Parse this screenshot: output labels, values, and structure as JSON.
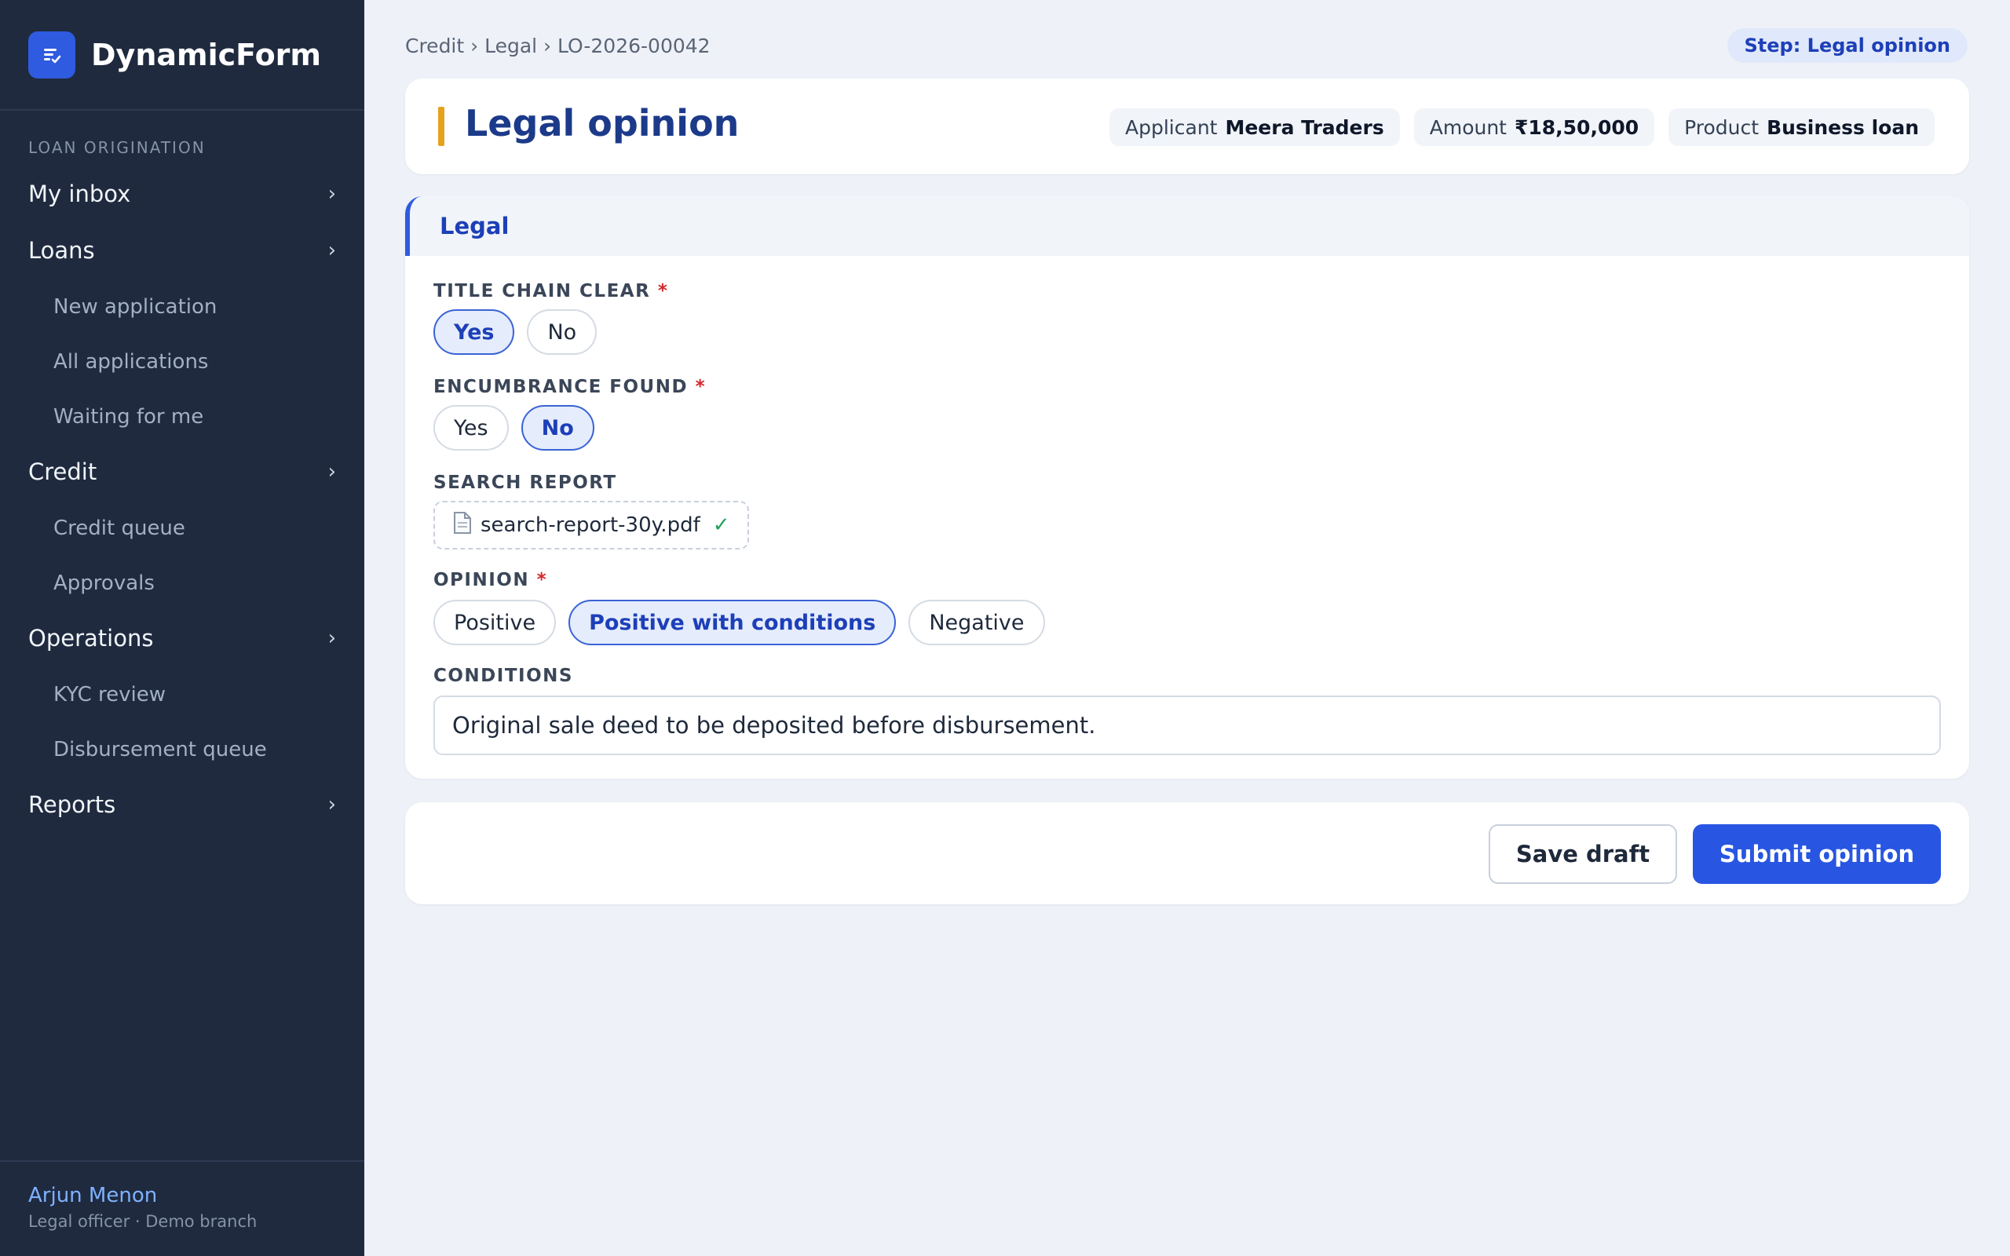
{
  "app": {
    "name": "DynamicForm"
  },
  "sidebar": {
    "section_label": "LOAN ORIGINATION",
    "items": [
      {
        "label": "My inbox",
        "chevron": "›"
      },
      {
        "label": "Loans",
        "chevron": "›",
        "children": [
          "New application",
          "All applications",
          "Waiting for me"
        ]
      },
      {
        "label": "Credit",
        "chevron": "›",
        "children": [
          "Credit queue",
          "Approvals"
        ]
      },
      {
        "label": "Operations",
        "chevron": "›",
        "children": [
          "KYC review",
          "Disbursement queue"
        ]
      },
      {
        "label": "Reports",
        "chevron": "›"
      }
    ],
    "user": {
      "name": "Arjun Menon",
      "role": "Legal officer · Demo branch"
    }
  },
  "breadcrumb": "Credit › Legal › LO-2026-00042",
  "step": "Step: Legal opinion",
  "header": {
    "title": "Legal opinion",
    "chips": [
      {
        "label": "Applicant",
        "value": "Meera Traders"
      },
      {
        "label": "Amount",
        "value": "₹18,50,000"
      },
      {
        "label": "Product",
        "value": "Business loan"
      }
    ]
  },
  "form": {
    "section": "Legal",
    "title_chain": {
      "label": "TITLE CHAIN CLEAR",
      "required": "*",
      "options": [
        "Yes",
        "No"
      ],
      "selected": "Yes"
    },
    "encumbrance": {
      "label": "ENCUMBRANCE FOUND",
      "required": "*",
      "options": [
        "Yes",
        "No"
      ],
      "selected": "No"
    },
    "search_report": {
      "label": "SEARCH REPORT",
      "file_name": "search-report-30y.pdf",
      "status_icon": "✓"
    },
    "opinion": {
      "label": "OPINION",
      "required": "*",
      "options": [
        "Positive",
        "Positive with conditions",
        "Negative"
      ],
      "selected": "Positive with conditions"
    },
    "conditions": {
      "label": "CONDITIONS",
      "value": "Original sale deed to be deposited before disbursement."
    }
  },
  "actions": {
    "save_draft": "Save draft",
    "submit": "Submit opinion"
  },
  "colors": {
    "sidebar_bg": "#1f2a3f",
    "accent": "#2856e2",
    "title_bar": "#e6a11f",
    "required": "#d3282e"
  }
}
